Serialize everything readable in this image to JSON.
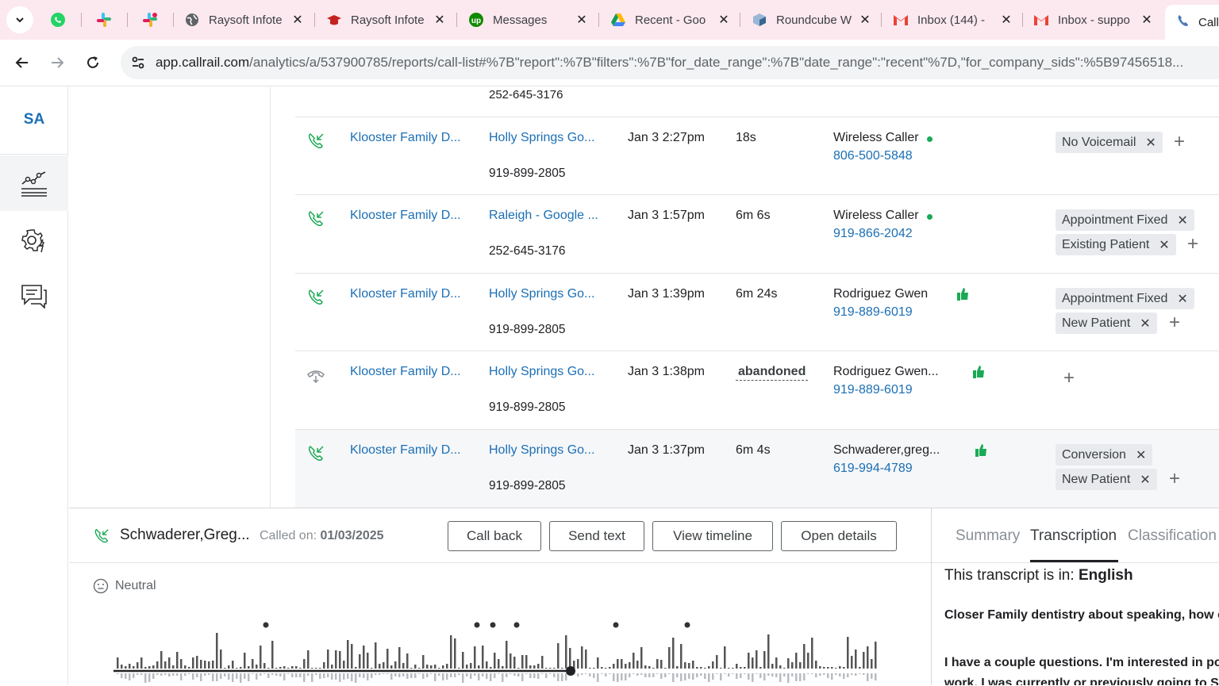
{
  "browser": {
    "tabs": [
      {
        "title": "",
        "icon": "whatsapp-icon",
        "color": "#25d366"
      },
      {
        "title": "",
        "icon": "slack-icon",
        "color": "#e01e5a"
      },
      {
        "title": "",
        "icon": "slack-icon",
        "color": "#e01e5a"
      },
      {
        "title": "Raysoft Infote",
        "icon": "globe-icon"
      },
      {
        "title": "Raysoft Infote",
        "icon": "graduation-cap-icon"
      },
      {
        "title": "Messages",
        "icon": "upwork-icon"
      },
      {
        "title": "Recent - Goo",
        "icon": "google-drive-icon"
      },
      {
        "title": "Roundcube W",
        "icon": "roundcube-icon"
      },
      {
        "title": "Inbox (144) -",
        "icon": "gmail-icon"
      },
      {
        "title": "Inbox - suppo",
        "icon": "gmail-icon"
      },
      {
        "title": "Call",
        "icon": "callrail-icon",
        "active": true
      }
    ],
    "url_host": "app.callrail.com",
    "url_path": "/analytics/a/537900785/reports/call-list#%7B\"report\":%7B\"filters\":%7B\"for_date_range\":%7B\"date_range\":\"recent\"%7D,\"for_company_sids\":%5B97456518..."
  },
  "sidebar": {
    "initials": "SA",
    "items": [
      {
        "icon": "analytics-chart-icon",
        "active": true
      },
      {
        "icon": "settings-gear-icon",
        "active": false
      },
      {
        "icon": "chat-messages-icon",
        "active": false
      }
    ]
  },
  "list": {
    "top_cut_number": "252-645-3176",
    "rows": [
      {
        "call_type": "inbound",
        "company": "Klooster Family D...",
        "source": "Holly Springs Go...",
        "tracking": "919-899-2805",
        "start": "Jan 3 2:27pm",
        "duration": "18s",
        "abandoned": false,
        "caller": "Wireless Caller",
        "phone": "806-500-5848",
        "indicator": "green-dot",
        "tags": [
          "No Voicemail"
        ]
      },
      {
        "call_type": "inbound",
        "company": "Klooster Family D...",
        "source": "Raleigh - Google ...",
        "tracking": "252-645-3176",
        "start": "Jan 3 1:57pm",
        "duration": "6m 6s",
        "abandoned": false,
        "caller": "Wireless Caller",
        "phone": "919-866-2042",
        "indicator": "green-dot",
        "tags": [
          "Appointment Fixed",
          "Existing Patient"
        ]
      },
      {
        "call_type": "inbound",
        "company": "Klooster Family D...",
        "source": "Holly Springs Go...",
        "tracking": "919-899-2805",
        "start": "Jan 3 1:39pm",
        "duration": "6m 24s",
        "abandoned": false,
        "caller": "Rodriguez Gwen",
        "phone": "919-889-6019",
        "indicator": "thumbs-up",
        "tags": [
          "Appointment Fixed",
          "New Patient"
        ]
      },
      {
        "call_type": "abandoned",
        "company": "Klooster Family D...",
        "source": "Holly Springs Go...",
        "tracking": "919-899-2805",
        "start": "Jan 3 1:38pm",
        "duration": "abandoned",
        "abandoned": true,
        "caller": "Rodriguez Gwen...",
        "phone": "919-889-6019",
        "indicator": "thumbs-up",
        "tags": []
      },
      {
        "call_type": "inbound",
        "company": "Klooster Family D...",
        "source": "Holly Springs Go...",
        "tracking": "919-899-2805",
        "start": "Jan 3 1:37pm",
        "duration": "6m 4s",
        "abandoned": false,
        "caller": "Schwaderer,greg...",
        "phone": "619-994-4789",
        "indicator": "thumbs-up",
        "tags": [
          "Conversion",
          "New Patient"
        ]
      }
    ]
  },
  "detail": {
    "caller_name": "Schwaderer,Greg...",
    "called_on_label": "Called on:",
    "called_on_date": "01/03/2025",
    "buttons": {
      "call_back": "Call back",
      "send_text": "Send text",
      "view_timeline": "View timeline",
      "open_details": "Open details"
    },
    "sentiment": "Neutral",
    "playback_position": 0.6
  },
  "right_panel": {
    "tabs": {
      "summary": "Summary",
      "transcription": "Transcription",
      "classification": "Classification"
    },
    "active_tab": "Transcription",
    "lang_label": "This transcript is in:",
    "lang_value": "English",
    "paragraph1": "Closer Family dentistry about speaking, how can I help you?",
    "paragraph2": "I have a couple questions. I'm interested in potentially",
    "paragraph3": "work. I was currently or previously going to Sisk"
  },
  "colors": {
    "link": "#1b6fb5",
    "accent_green": "#1aaa55",
    "tabbar": "#fce8ef"
  }
}
